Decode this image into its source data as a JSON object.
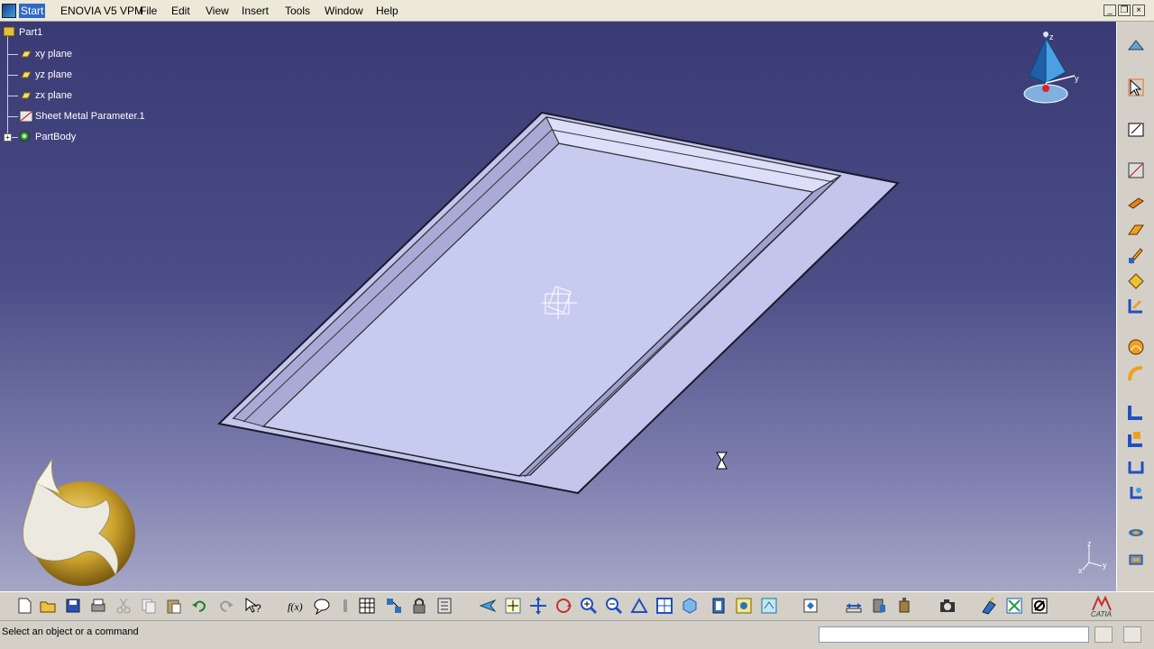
{
  "menubar": {
    "items": [
      "Start",
      "ENOVIA V5 VPM",
      "File",
      "Edit",
      "View",
      "Insert",
      "Tools",
      "Window",
      "Help"
    ]
  },
  "tree": {
    "root": "Part1",
    "items": [
      "xy plane",
      "yz plane",
      "zx plane",
      "Sheet Metal Parameter.1",
      "PartBody"
    ]
  },
  "compass": {
    "z_label": "z",
    "y_label": "y"
  },
  "axis_triad": {
    "z": "z",
    "y": "y",
    "x": "x"
  },
  "status": {
    "message": "Select an object or a command"
  },
  "brand": {
    "logo_text": "CATIA"
  },
  "colors": {
    "part_face": "#c3c5ec",
    "viewport_top": "#3a3a74",
    "viewport_bottom": "#a6a6c6",
    "accent": "#316ac5"
  }
}
